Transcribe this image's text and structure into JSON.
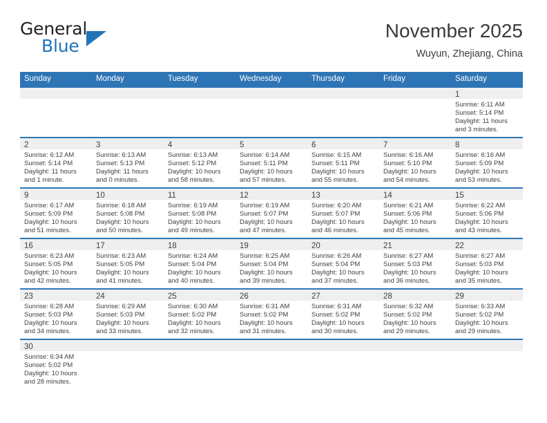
{
  "brand": {
    "name_part1": "General",
    "name_part2": "Blue",
    "accent_color": "#1f73b7",
    "triangle_icon": "brand-triangle-icon"
  },
  "header": {
    "title": "November 2025",
    "subtitle": "Wuyun, Zhejiang, China"
  },
  "theme": {
    "header_bar_color": "#2e75b6",
    "day_band_color": "#efefef",
    "text_color": "#404040"
  },
  "weekdays": [
    "Sunday",
    "Monday",
    "Tuesday",
    "Wednesday",
    "Thursday",
    "Friday",
    "Saturday"
  ],
  "weeks": [
    [
      {
        "day": "",
        "sunrise": "",
        "sunset": "",
        "daylight": ""
      },
      {
        "day": "",
        "sunrise": "",
        "sunset": "",
        "daylight": ""
      },
      {
        "day": "",
        "sunrise": "",
        "sunset": "",
        "daylight": ""
      },
      {
        "day": "",
        "sunrise": "",
        "sunset": "",
        "daylight": ""
      },
      {
        "day": "",
        "sunrise": "",
        "sunset": "",
        "daylight": ""
      },
      {
        "day": "",
        "sunrise": "",
        "sunset": "",
        "daylight": ""
      },
      {
        "day": "1",
        "sunrise": "Sunrise: 6:11 AM",
        "sunset": "Sunset: 5:14 PM",
        "daylight": "Daylight: 11 hours and 3 minutes."
      }
    ],
    [
      {
        "day": "2",
        "sunrise": "Sunrise: 6:12 AM",
        "sunset": "Sunset: 5:14 PM",
        "daylight": "Daylight: 11 hours and 1 minute."
      },
      {
        "day": "3",
        "sunrise": "Sunrise: 6:13 AM",
        "sunset": "Sunset: 5:13 PM",
        "daylight": "Daylight: 11 hours and 0 minutes."
      },
      {
        "day": "4",
        "sunrise": "Sunrise: 6:13 AM",
        "sunset": "Sunset: 5:12 PM",
        "daylight": "Daylight: 10 hours and 58 minutes."
      },
      {
        "day": "5",
        "sunrise": "Sunrise: 6:14 AM",
        "sunset": "Sunset: 5:11 PM",
        "daylight": "Daylight: 10 hours and 57 minutes."
      },
      {
        "day": "6",
        "sunrise": "Sunrise: 6:15 AM",
        "sunset": "Sunset: 5:11 PM",
        "daylight": "Daylight: 10 hours and 55 minutes."
      },
      {
        "day": "7",
        "sunrise": "Sunrise: 6:16 AM",
        "sunset": "Sunset: 5:10 PM",
        "daylight": "Daylight: 10 hours and 54 minutes."
      },
      {
        "day": "8",
        "sunrise": "Sunrise: 6:16 AM",
        "sunset": "Sunset: 5:09 PM",
        "daylight": "Daylight: 10 hours and 53 minutes."
      }
    ],
    [
      {
        "day": "9",
        "sunrise": "Sunrise: 6:17 AM",
        "sunset": "Sunset: 5:09 PM",
        "daylight": "Daylight: 10 hours and 51 minutes."
      },
      {
        "day": "10",
        "sunrise": "Sunrise: 6:18 AM",
        "sunset": "Sunset: 5:08 PM",
        "daylight": "Daylight: 10 hours and 50 minutes."
      },
      {
        "day": "11",
        "sunrise": "Sunrise: 6:19 AM",
        "sunset": "Sunset: 5:08 PM",
        "daylight": "Daylight: 10 hours and 49 minutes."
      },
      {
        "day": "12",
        "sunrise": "Sunrise: 6:19 AM",
        "sunset": "Sunset: 5:07 PM",
        "daylight": "Daylight: 10 hours and 47 minutes."
      },
      {
        "day": "13",
        "sunrise": "Sunrise: 6:20 AM",
        "sunset": "Sunset: 5:07 PM",
        "daylight": "Daylight: 10 hours and 46 minutes."
      },
      {
        "day": "14",
        "sunrise": "Sunrise: 6:21 AM",
        "sunset": "Sunset: 5:06 PM",
        "daylight": "Daylight: 10 hours and 45 minutes."
      },
      {
        "day": "15",
        "sunrise": "Sunrise: 6:22 AM",
        "sunset": "Sunset: 5:06 PM",
        "daylight": "Daylight: 10 hours and 43 minutes."
      }
    ],
    [
      {
        "day": "16",
        "sunrise": "Sunrise: 6:23 AM",
        "sunset": "Sunset: 5:05 PM",
        "daylight": "Daylight: 10 hours and 42 minutes."
      },
      {
        "day": "17",
        "sunrise": "Sunrise: 6:23 AM",
        "sunset": "Sunset: 5:05 PM",
        "daylight": "Daylight: 10 hours and 41 minutes."
      },
      {
        "day": "18",
        "sunrise": "Sunrise: 6:24 AM",
        "sunset": "Sunset: 5:04 PM",
        "daylight": "Daylight: 10 hours and 40 minutes."
      },
      {
        "day": "19",
        "sunrise": "Sunrise: 6:25 AM",
        "sunset": "Sunset: 5:04 PM",
        "daylight": "Daylight: 10 hours and 39 minutes."
      },
      {
        "day": "20",
        "sunrise": "Sunrise: 6:26 AM",
        "sunset": "Sunset: 5:04 PM",
        "daylight": "Daylight: 10 hours and 37 minutes."
      },
      {
        "day": "21",
        "sunrise": "Sunrise: 6:27 AM",
        "sunset": "Sunset: 5:03 PM",
        "daylight": "Daylight: 10 hours and 36 minutes."
      },
      {
        "day": "22",
        "sunrise": "Sunrise: 6:27 AM",
        "sunset": "Sunset: 5:03 PM",
        "daylight": "Daylight: 10 hours and 35 minutes."
      }
    ],
    [
      {
        "day": "23",
        "sunrise": "Sunrise: 6:28 AM",
        "sunset": "Sunset: 5:03 PM",
        "daylight": "Daylight: 10 hours and 34 minutes."
      },
      {
        "day": "24",
        "sunrise": "Sunrise: 6:29 AM",
        "sunset": "Sunset: 5:03 PM",
        "daylight": "Daylight: 10 hours and 33 minutes."
      },
      {
        "day": "25",
        "sunrise": "Sunrise: 6:30 AM",
        "sunset": "Sunset: 5:02 PM",
        "daylight": "Daylight: 10 hours and 32 minutes."
      },
      {
        "day": "26",
        "sunrise": "Sunrise: 6:31 AM",
        "sunset": "Sunset: 5:02 PM",
        "daylight": "Daylight: 10 hours and 31 minutes."
      },
      {
        "day": "27",
        "sunrise": "Sunrise: 6:31 AM",
        "sunset": "Sunset: 5:02 PM",
        "daylight": "Daylight: 10 hours and 30 minutes."
      },
      {
        "day": "28",
        "sunrise": "Sunrise: 6:32 AM",
        "sunset": "Sunset: 5:02 PM",
        "daylight": "Daylight: 10 hours and 29 minutes."
      },
      {
        "day": "29",
        "sunrise": "Sunrise: 6:33 AM",
        "sunset": "Sunset: 5:02 PM",
        "daylight": "Daylight: 10 hours and 29 minutes."
      }
    ],
    [
      {
        "day": "30",
        "sunrise": "Sunrise: 6:34 AM",
        "sunset": "Sunset: 5:02 PM",
        "daylight": "Daylight: 10 hours and 28 minutes."
      },
      {
        "day": "",
        "sunrise": "",
        "sunset": "",
        "daylight": ""
      },
      {
        "day": "",
        "sunrise": "",
        "sunset": "",
        "daylight": ""
      },
      {
        "day": "",
        "sunrise": "",
        "sunset": "",
        "daylight": ""
      },
      {
        "day": "",
        "sunrise": "",
        "sunset": "",
        "daylight": ""
      },
      {
        "day": "",
        "sunrise": "",
        "sunset": "",
        "daylight": ""
      },
      {
        "day": "",
        "sunrise": "",
        "sunset": "",
        "daylight": ""
      }
    ]
  ]
}
